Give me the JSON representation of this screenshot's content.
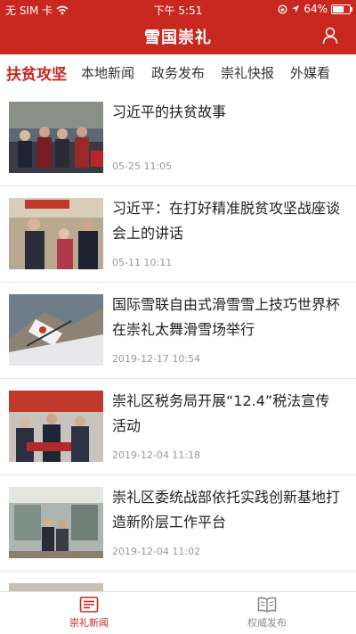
{
  "status_bar": {
    "carrier": "无 SIM 卡",
    "time": "下午 5:51",
    "battery": "64%",
    "battery_level": 0.64
  },
  "header": {
    "title": "雪国崇礼"
  },
  "tabs": [
    {
      "label": "扶贫攻坚",
      "active": true
    },
    {
      "label": "本地新闻",
      "active": false
    },
    {
      "label": "政务发布",
      "active": false
    },
    {
      "label": "崇礼快报",
      "active": false
    },
    {
      "label": "外媒看",
      "active": false
    }
  ],
  "news": [
    {
      "title": "习近平的扶贫故事",
      "date": "05-25 11:05"
    },
    {
      "title": "习近平：在打好精准脱贫攻坚战座谈会上的讲话",
      "date": "05-11 10:11"
    },
    {
      "title": "国际雪联自由式滑雪雪上技巧世界杯 在崇礼太舞滑雪场举行",
      "date": "2019-12-17 10:54"
    },
    {
      "title": "崇礼区税务局开展“12.4”税法宣传活动",
      "date": "2019-12-04 11:18"
    },
    {
      "title": "崇礼区委统战部依托实践创新基地打造新阶层工作平台",
      "date": "2019-12-04 11:02"
    }
  ],
  "bottom_nav": [
    {
      "label": "崇礼新闻",
      "icon": "newspaper-icon",
      "active": true
    },
    {
      "label": "权威发布",
      "icon": "book-icon",
      "active": false
    }
  ],
  "colors": {
    "brand": "#c8281f"
  }
}
